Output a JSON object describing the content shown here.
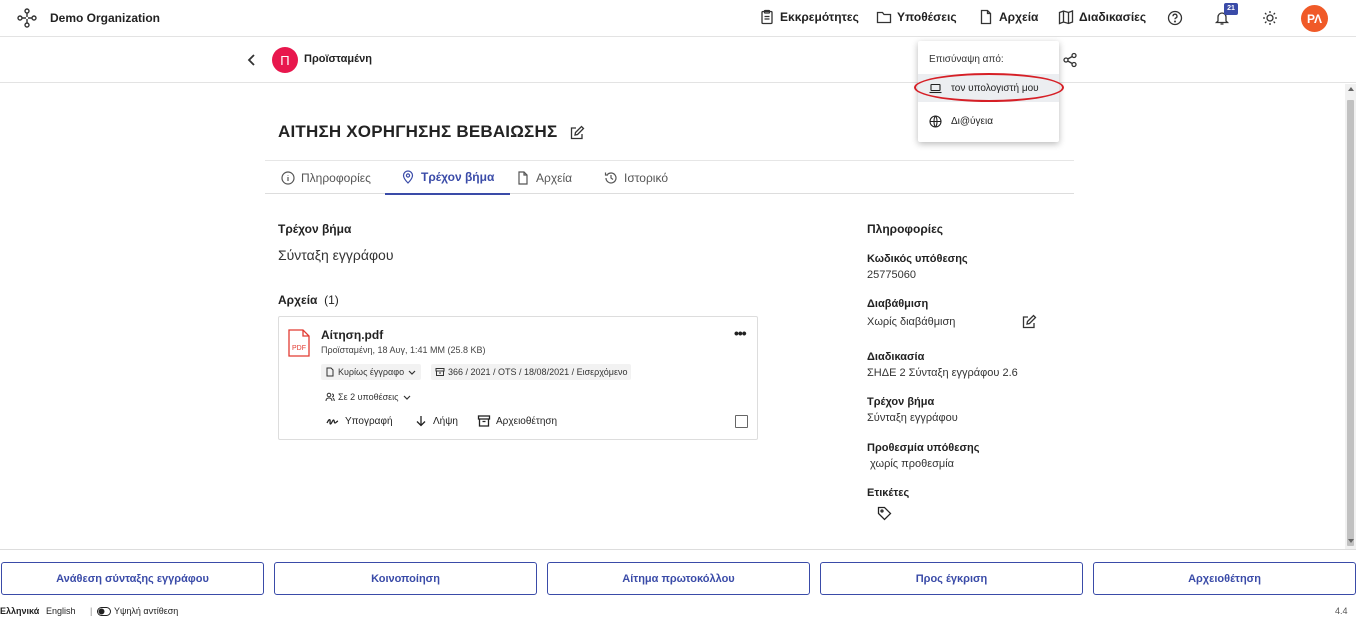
{
  "header": {
    "org_name": "Demo Organization",
    "nav": [
      {
        "label": "Εκκρεμότητες",
        "icon": "clipboard-icon"
      },
      {
        "label": "Υποθέσεις",
        "icon": "folder-icon"
      },
      {
        "label": "Αρχεία",
        "icon": "file-icon"
      },
      {
        "label": "Διαδικασίες",
        "icon": "map-icon"
      }
    ],
    "notifications_count": "21",
    "user_initials": "ΡΛ",
    "colors": {
      "accent": "#3a4ba8",
      "avatar": "#f05a28",
      "p_avatar": "#e8174d",
      "highlight": "#d61f26"
    }
  },
  "subheader": {
    "avatar_letter": "Π",
    "name": "Προϊσταμένη"
  },
  "attach_menu": {
    "title": "Επισύναψη από:",
    "items": [
      "τον υπολογιστή μου",
      "Δι@ύγεια"
    ]
  },
  "main": {
    "title": "ΑΙΤΗΣΗ ΧΟΡΗΓΗΣΗΣ ΒΕΒΑΙΩΣΗΣ",
    "tabs": [
      "Πληροφορίες",
      "Τρέχον βήμα",
      "Αρχεία",
      "Ιστορικό"
    ],
    "active_tab": "Τρέχον βήμα",
    "current_step_label": "Τρέχον βήμα",
    "current_step_value": "Σύνταξη εγγράφου",
    "files_label": "Αρχεία",
    "files_count": "(1)",
    "file": {
      "name": "Αίτηση.pdf",
      "meta": "Προϊσταμένη,  18 Αυγ, 1:41 ΜΜ (25.8 KB)",
      "doc_type": "Κυρίως έγγραφο",
      "protocol": "366 / 2021 / OTS / 18/08/2021 / Εισερχόμενο",
      "cases": "Σε 2 υποθέσεις",
      "actions": [
        "Υπογραφή",
        "Λήψη",
        "Αρχειοθέτηση"
      ],
      "pdf_label": "PDF"
    }
  },
  "info_panel": {
    "heading": "Πληροφορίες",
    "fields": [
      {
        "label": "Κωδικός υπόθεσης",
        "value": "25775060"
      },
      {
        "label": "Διαβάθμιση",
        "value": "Χωρίς διαβάθμιση"
      },
      {
        "label": "Διαδικασία",
        "value": "ΣΗΔΕ 2 Σύνταξη εγγράφου 2.6"
      },
      {
        "label": "Τρέχον βήμα",
        "value": "Σύνταξη εγγράφου"
      },
      {
        "label": "Προθεσμία υπόθεσης",
        "value": "χωρίς προθεσμία"
      },
      {
        "label": "Ετικέτες",
        "value": ""
      }
    ]
  },
  "bottom_actions": [
    "Ανάθεση σύνταξης εγγράφου",
    "Κοινοποίηση",
    "Αίτημα πρωτοκόλλου",
    "Προς έγκριση",
    "Αρχειοθέτηση"
  ],
  "footer": {
    "lang_el": "Ελληνικά",
    "lang_en": "English",
    "contrast": "Υψηλή αντίθεση",
    "version": "4.4"
  }
}
